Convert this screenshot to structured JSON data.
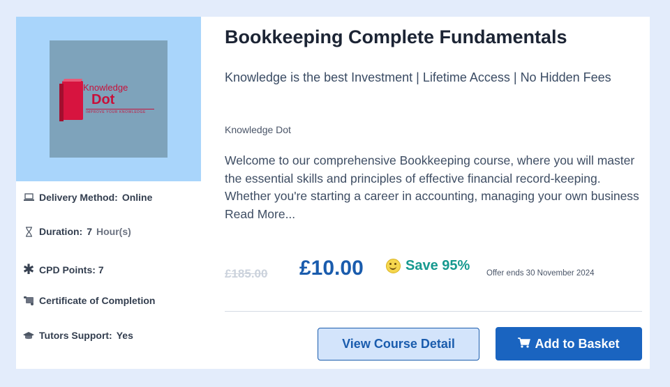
{
  "course": {
    "title": "Bookkeeping Complete Fundamentals",
    "subtitle": "Knowledge is the best Investment | Lifetime Access | No Hidden Fees",
    "provider": "Knowledge Dot",
    "description": "Welcome to our comprehensive Bookkeeping course, where you will master the essential skills and principles of effective financial record-keeping. Whether you're starting a career in accounting, managing your own business Read More..."
  },
  "logo": {
    "line1": "Knowledge",
    "line2": "Dot",
    "tagline": "IMPROVE YOUR KNOWLEDGE"
  },
  "meta": {
    "delivery_label": "Delivery Method:",
    "delivery_value": "Online",
    "duration_label": "Duration:",
    "duration_value": "7",
    "duration_unit": "Hour(s)",
    "cpd_label": "CPD Points:",
    "cpd_value": "7",
    "certificate_label": "Certificate of Completion",
    "tutor_label": "Tutors Support:",
    "tutor_value": "Yes"
  },
  "pricing": {
    "old_price": "£185.00",
    "price": "£10.00",
    "save_text": "Save 95%",
    "offer_text": "Offer ends 30 November 2024"
  },
  "buttons": {
    "view_detail": "View Course Detail",
    "add_basket": "Add to Basket"
  },
  "colors": {
    "accent": "#1a64c0",
    "save_green": "#16998f",
    "page_bg": "#e3ecfb"
  }
}
